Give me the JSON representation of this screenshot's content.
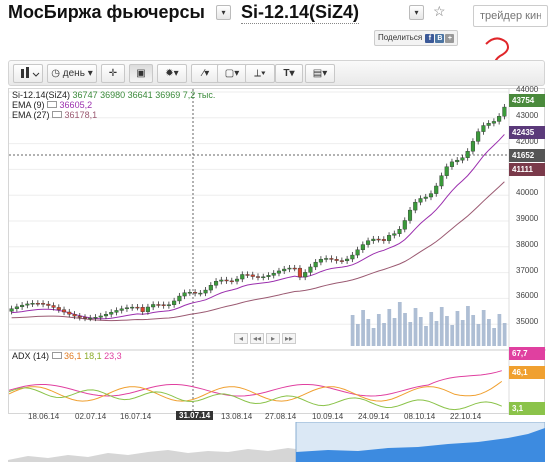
{
  "header": {
    "market_title": "МосБиржа фьючерсы",
    "instrument": "Si-12.14(SiZ4)",
    "star": "☆",
    "search_placeholder": "трейдер кино",
    "share_label": "Поделиться",
    "share_icons": [
      "f",
      "B",
      "+"
    ]
  },
  "annotation": {
    "text": "?",
    "color": "#e0262a"
  },
  "toolbar": {
    "chart_type_icon": "candles-icon",
    "period_label": "день",
    "tools": [
      "crosshair-icon",
      "select-icon",
      "indicators-icon",
      "pen-icon",
      "shapes-icon",
      "fibonacci-icon",
      "text-icon",
      "image-icon"
    ]
  },
  "legend": {
    "ticker": "Si-12.14(SiZ4)",
    "ohlc": [
      "36747",
      "36980",
      "36641",
      "36969"
    ],
    "volume": "7,2 тыс.",
    "ema9_label": "EMA (9)",
    "ema9_value": "36605,2",
    "ema27_label": "EMA (27)",
    "ema27_value": "36178,1",
    "adx_label": "ADX (14)",
    "adx_values": [
      "36,1",
      "18,1",
      "23,3"
    ]
  },
  "price_axis": [
    "44000",
    "43000",
    "42000",
    "41000",
    "40000",
    "39000",
    "38000",
    "37000",
    "36000",
    "35000"
  ],
  "price_tags": [
    {
      "value": "43754",
      "color": "#4a8a3c"
    },
    {
      "value": "42435",
      "color": "#5b3a7a"
    },
    {
      "value": "41652",
      "color": "#555555"
    },
    {
      "value": "41111",
      "color": "#7a3a4a"
    }
  ],
  "adx_tags": [
    {
      "value": "67,7",
      "color": "#e040a0"
    },
    {
      "value": "46,1",
      "color": "#f0a030"
    },
    {
      "value": "3,1",
      "color": "#8bc34a"
    }
  ],
  "date_axis": [
    "18.06.14",
    "02.07.14",
    "16.07.14",
    "31.07.14",
    "13.08.14",
    "27.08.14",
    "10.09.14",
    "24.09.14",
    "08.10.14",
    "22.10.14"
  ],
  "cursor_date": "31.07.14",
  "scroll_buttons": [
    "◂",
    "◂◂",
    "▸",
    "▸▸"
  ],
  "colors": {
    "up": "#3a9a3a",
    "down": "#d9452f",
    "ema9": "#9b2fae",
    "ema27": "#9b5a72",
    "volume": "#9aaec9"
  },
  "chart_data": {
    "type": "candlestick",
    "ylim": [
      34500,
      44200
    ],
    "ema9_last": 42435,
    "ema27_last": 41111,
    "last_close": 43754,
    "cursor_price": 41652,
    "adx_last": [
      67.7,
      46.1,
      3.1
    ]
  }
}
